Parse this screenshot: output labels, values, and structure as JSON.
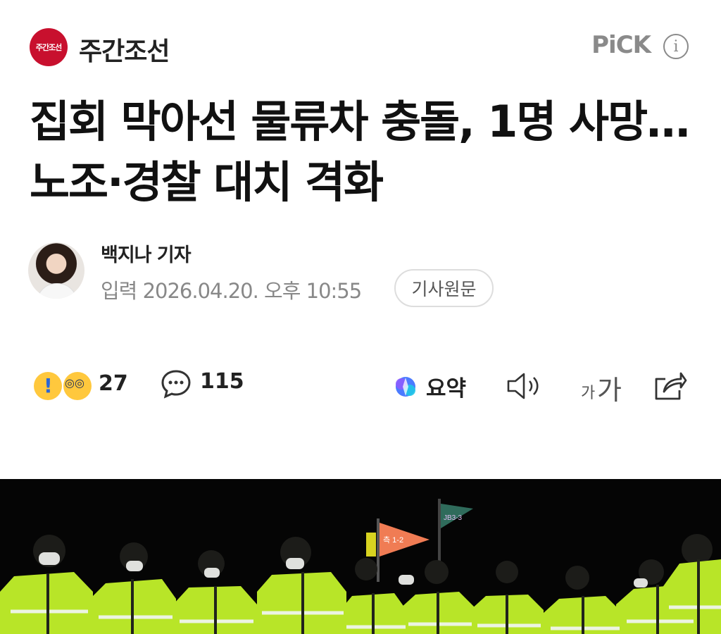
{
  "header": {
    "logo_text": "주간조선",
    "press_name": "주간조선",
    "pick_label": "PiCK",
    "info_icon": "info-icon"
  },
  "article": {
    "title": "집회 막아선 물류차 충돌, 1명 사망…노조·경찰 대치 격화",
    "reporter": "백지나 기자",
    "date": "입력 2026.04.20. 오후 10:55",
    "original_button": "기사원문"
  },
  "toolbar": {
    "reaction_count": "27",
    "comment_count": "115",
    "summary_label": "요약",
    "font_small": "가",
    "font_large": "가",
    "icons": [
      "reaction-emoji-icon",
      "comment-icon",
      "summary-icon",
      "speaker-icon",
      "font-size-icon",
      "share-icon"
    ]
  },
  "colors": {
    "brand_red": "#c8102e",
    "muted_gray": "#8a8a8a",
    "vest_yellow": "#d4ff3a"
  },
  "photo": {
    "flag_left": "측 1-2",
    "flag_right": "JB3-3"
  }
}
